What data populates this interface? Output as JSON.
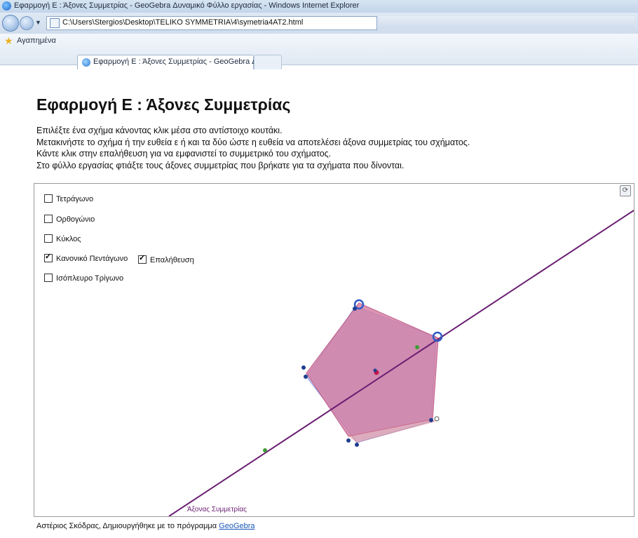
{
  "window": {
    "title": "Εφαρμογή Ε : Άξονες Συμμετρίας - GeoGebra Δυναμικό Φύλλο εργασίας - Windows Internet Explorer"
  },
  "browser": {
    "url": "C:\\Users\\Stergios\\Desktop\\TELIKO SYMMETRIA\\4\\symetria4AT2.html",
    "favorites_label": "Αγαπημένα",
    "tab_title": "Εφαρμογή Ε : Άξονες Συμμετρίας - GeoGebra Δυ..."
  },
  "page": {
    "title": "Εφαρμογή Ε : Άξονες Συμμετρίας",
    "instructions": [
      "Επιλέξτε ένα σχήμα κάνοντας κλικ μέσα στο αντίστοιχο κουτάκι.",
      "Μετακινήστε το σχήμα ή την ευθεία ε ή και τα δύο ώστε η ευθεία να αποτελέσει άξονα συμμετρίας του σχήματος.",
      "Κάντε κλικ στην επαλήθευση για να εμφανιστεί το συμμετρικό του σχήματος.",
      "Στο φύλλο εργασίας φτιάξτε τους άξονες συμμετρίας που βρήκατε για τα σχήματα που δίνονται."
    ],
    "footer_text": "Αστέριος Σκόδρας, Δημιουργήθηκε με το πρόγραμμα ",
    "footer_link": "GeoGebra"
  },
  "applet": {
    "checkboxes": [
      {
        "label": "Τετράγωνο",
        "checked": false
      },
      {
        "label": "Ορθογώνιο",
        "checked": false
      },
      {
        "label": "Κύκλος",
        "checked": false
      },
      {
        "label": "Κανονικό Πεντάγωνο",
        "checked": true
      },
      {
        "label": "Ισόπλευρο Τρίγωνο",
        "checked": false
      }
    ],
    "verify_checkbox": {
      "label": "Επαλήθευση",
      "checked": true
    },
    "axis_label": "Άξονας Συμμετρίας",
    "colors": {
      "axis": "#6a1f72",
      "pentagon_fill": "#d27aa0",
      "reflection_fill": "#9aa6e8",
      "point": "#1f3f8f",
      "midpoint": "#c0174b",
      "green_point": "#3f9b35"
    }
  }
}
